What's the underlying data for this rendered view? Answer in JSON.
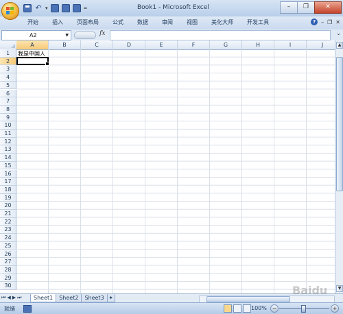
{
  "window": {
    "title": "Book1 - Microsoft Excel"
  },
  "ribbon": {
    "tabs": [
      "开始",
      "插入",
      "页面布局",
      "公式",
      "数据",
      "审阅",
      "视图",
      "美化大师",
      "开发工具"
    ]
  },
  "formula_bar": {
    "name_box": "A2",
    "fx_label": "fx",
    "content": ""
  },
  "grid": {
    "columns": [
      "A",
      "B",
      "C",
      "D",
      "E",
      "F",
      "G",
      "H",
      "I",
      "J"
    ],
    "rows": [
      "1",
      "2",
      "3",
      "4",
      "5",
      "6",
      "7",
      "8",
      "9",
      "10",
      "11",
      "12",
      "13",
      "14",
      "15",
      "16",
      "17",
      "18",
      "19",
      "20",
      "21",
      "22",
      "23",
      "24",
      "25",
      "26",
      "27",
      "28",
      "29",
      "30"
    ],
    "cell_A1": "我是中国人",
    "selected_cell": "A2"
  },
  "sheets": {
    "tabs": [
      "Sheet1",
      "Sheet2",
      "Sheet3"
    ],
    "active": "Sheet1"
  },
  "status": {
    "ready": "就绪",
    "zoom": "100%"
  },
  "watermark": {
    "text": "Baidu 经验"
  },
  "colors": {
    "accent": "#f7c978",
    "ribbon": "#c9d9ee",
    "grid_line": "#d9dfe8"
  }
}
